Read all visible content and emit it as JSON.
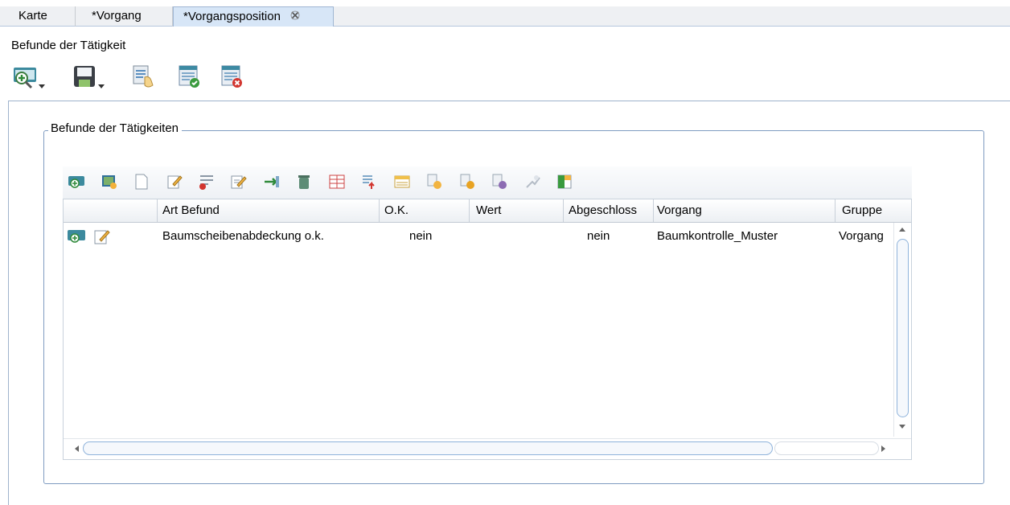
{
  "tabs": [
    {
      "label": "Karte",
      "active": false
    },
    {
      "label": "*Vorgang",
      "active": false
    },
    {
      "label": "*Vorgangsposition",
      "active": true,
      "close_icon": "close-tab-icon"
    }
  ],
  "section": {
    "title": "Befunde der Tätigkeit"
  },
  "toolbar": {
    "buttons": [
      {
        "icon": "view-dropdown-icon",
        "has_dropdown": true
      },
      {
        "icon": "save-dropdown-icon",
        "has_dropdown": true
      },
      {
        "icon": "edit-select-icon",
        "has_dropdown": false
      },
      {
        "icon": "form-accept-icon",
        "has_dropdown": false
      },
      {
        "icon": "form-reject-icon",
        "has_dropdown": false
      }
    ]
  },
  "groupbox": {
    "title": "Befunde der Tätigkeiten",
    "toolbar_icons": [
      "view-icon",
      "map-icon",
      "new-icon",
      "edit-icon",
      "multi-delete-icon",
      "multi-edit-icon",
      "transfer-icon",
      "trash-icon",
      "table-icon",
      "export-icon",
      "list-icon",
      "doc-add-icon",
      "doc-yellow-icon",
      "doc-purple-icon",
      "link-icon",
      "table-config-icon"
    ],
    "table": {
      "columns": [
        "",
        "Art Befund",
        "O.K.",
        "Wert",
        "Abgeschloss",
        "Vorgang",
        "Gruppe"
      ],
      "rows": [
        {
          "art_befund": "Baumscheibenabdeckung o.k.",
          "ok": "nein",
          "wert": "",
          "abgeschlossen": "nein",
          "vorgang": "Baumkontrolle_Muster",
          "gruppe": "Vorgang"
        }
      ]
    }
  }
}
